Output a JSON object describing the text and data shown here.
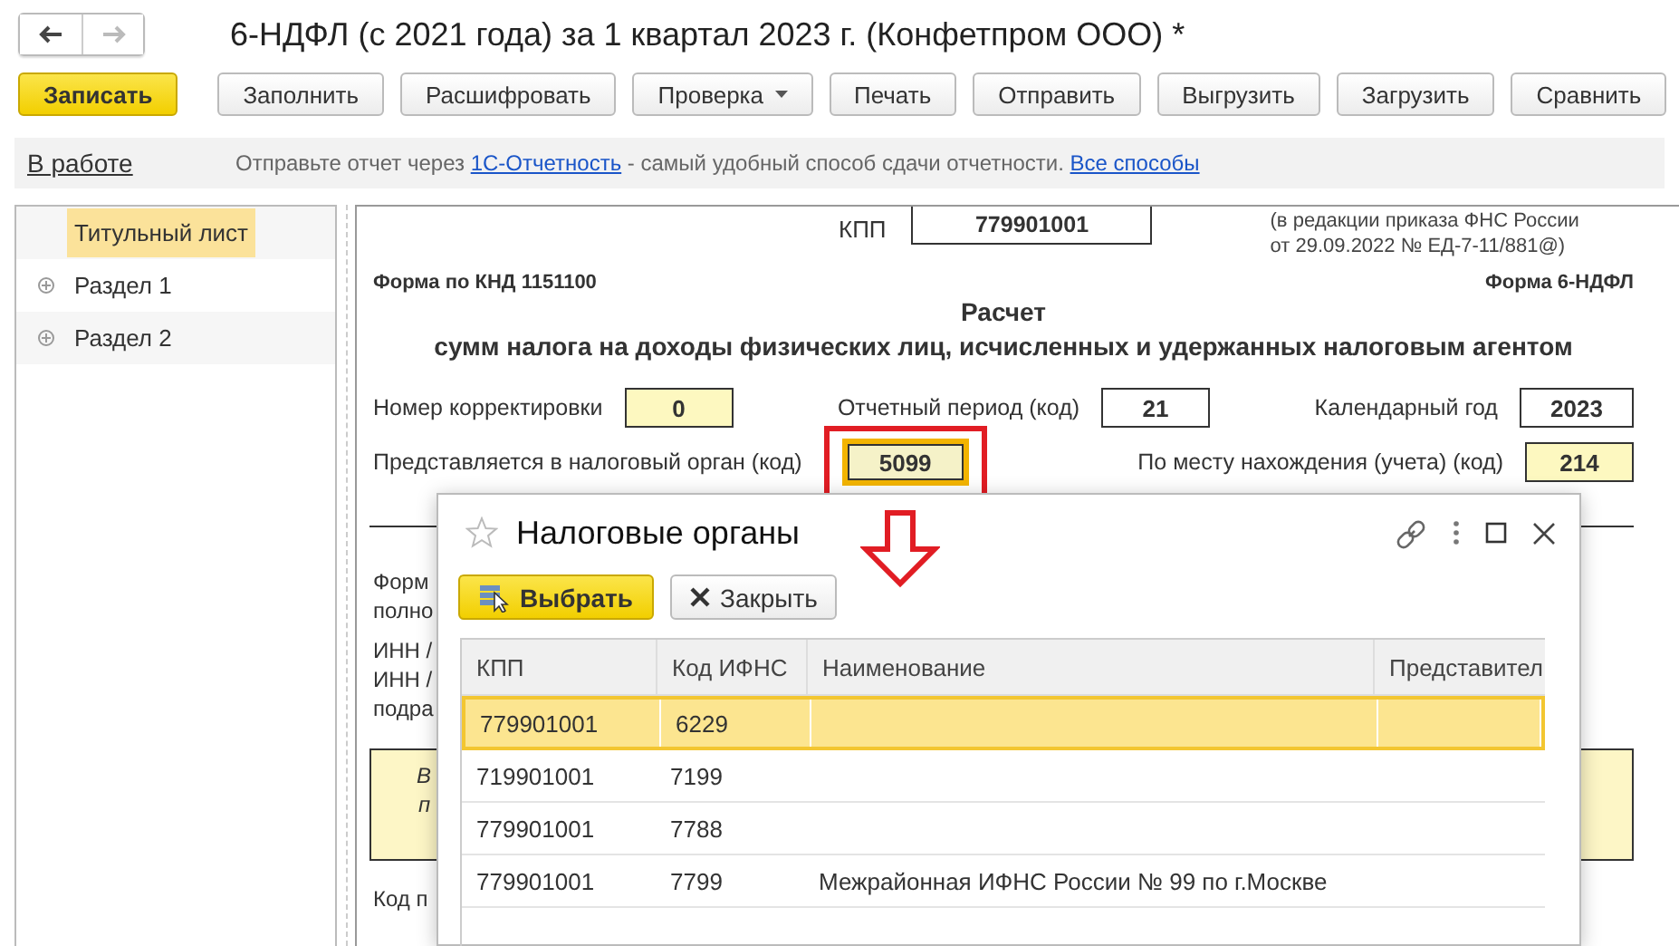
{
  "nav": [
    {
      "kind": "back",
      "disabled": false
    },
    {
      "kind": "forward",
      "disabled": true
    }
  ],
  "title": "6-НДФЛ (с 2021 года) за 1 квартал 2023 г. (Конфетпром ООО) *",
  "toolbar": [
    {
      "label": "Записать",
      "kind": "primary"
    },
    {
      "label": "Заполнить",
      "kind": "plain"
    },
    {
      "label": "Расшифровать",
      "kind": "plain"
    },
    {
      "label": "Проверка",
      "kind": "dropdown"
    },
    {
      "label": "Печать",
      "kind": "plain"
    },
    {
      "label": "Отправить",
      "kind": "plain"
    },
    {
      "label": "Выгрузить",
      "kind": "plain"
    },
    {
      "label": "Загрузить",
      "kind": "plain"
    },
    {
      "label": "Сравнить",
      "kind": "plain"
    }
  ],
  "info_bar": {
    "status": "В работе",
    "message": [
      {
        "kind": "text",
        "text": "Отправьте отчет через "
      },
      {
        "kind": "link",
        "text": "1С-Отчетность"
      },
      {
        "kind": "text",
        "text": " - самый удобный способ сдачи отчетности. "
      },
      {
        "kind": "link",
        "text": "Все способы"
      }
    ]
  },
  "sidebar": {
    "items": [
      {
        "label": "Титульный лист",
        "selected": true,
        "expandable": false
      },
      {
        "label": "Раздел 1",
        "selected": false,
        "expandable": true
      },
      {
        "label": "Раздел 2",
        "selected": false,
        "expandable": true
      }
    ]
  },
  "form": {
    "kpp_label": "КПП",
    "kpp": "779901001",
    "note": [
      "(в редакции приказа ФНС России",
      "от 29.09.2022 № ЕД-7-11/881@)"
    ],
    "knd": "Форма по КНД 1151100",
    "form_name": "Форма 6-НДФЛ",
    "heading": "Расчет",
    "subheading": "сумм налога на доходы физических лиц, исчисленных и удержанных налоговым агентом",
    "period_fields": [
      {
        "label": "Номер корректировки",
        "value": "0",
        "editable": true,
        "focused": false,
        "marked": false
      },
      {
        "label": "Отчетный период (код)",
        "value": "21",
        "editable": false,
        "focused": false,
        "marked": false
      },
      {
        "label": "Календарный год",
        "value": "2023",
        "editable": false,
        "focused": false,
        "marked": false
      }
    ],
    "office_fields": [
      {
        "label": "Представляется в налоговый орган (код)",
        "value": "5099",
        "editable": true,
        "focused": true,
        "marked": true
      },
      {
        "label": "По месту нахождения (учета) (код)",
        "value": "214",
        "editable": true,
        "focused": false,
        "marked": false
      }
    ],
    "hidden_lines": [
      [
        "Форм",
        "полно"
      ],
      [
        "ИНН /",
        "ИНН /",
        "подра"
      ]
    ],
    "notice": [
      "В",
      "п"
    ],
    "last_line": "Код п"
  },
  "dialog": {
    "title": "Налоговые органы",
    "favorite": false,
    "buttons": [
      {
        "label": "Выбрать",
        "kind": "choose"
      },
      {
        "label": "Закрыть",
        "kind": "close"
      }
    ],
    "columns": [
      "КПП",
      "Код ИФНС",
      "Наименование",
      "Представител"
    ],
    "rows": [
      {
        "cells": [
          "779901001",
          "6229",
          "",
          ""
        ],
        "selected": true
      },
      {
        "cells": [
          "719901001",
          "7199",
          "",
          ""
        ],
        "selected": false
      },
      {
        "cells": [
          "779901001",
          "7788",
          "",
          ""
        ],
        "selected": false
      },
      {
        "cells": [
          "779901001",
          "7799",
          "Межрайонная ИФНС России № 99 по г.Москве",
          ""
        ],
        "selected": false
      }
    ]
  }
}
